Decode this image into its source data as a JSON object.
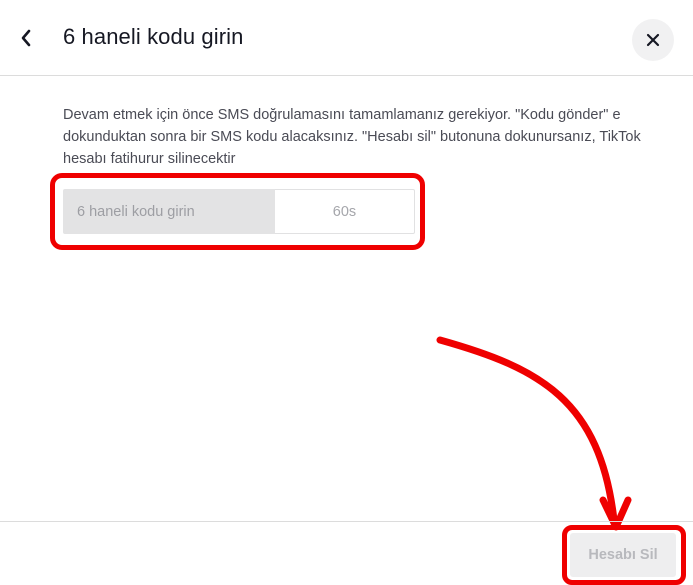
{
  "header": {
    "title": "6 haneli kodu girin",
    "back_icon": "chevron-left-icon",
    "close_icon": "close-icon"
  },
  "body": {
    "description": "Devam etmek için önce SMS doğrulamasını tamamlamanız gerekiyor. \"Kodu gönder\" e dokunduktan sonra bir SMS kodu alacaksınız. \"Hesabı sil\" butonuna dokunursanız, TikTok hesabı fatihurur silinecektir",
    "code_input": {
      "placeholder": "6 haneli kodu girin",
      "value": ""
    },
    "timer_label": "60s"
  },
  "footer": {
    "delete_label": "Hesabı Sil"
  },
  "colors": {
    "annotation": "#ef0000",
    "title_text": "#161823",
    "body_text": "#4a4b55",
    "input_bg": "#e3e3e4",
    "disabled_button_bg": "#eeeeef"
  }
}
